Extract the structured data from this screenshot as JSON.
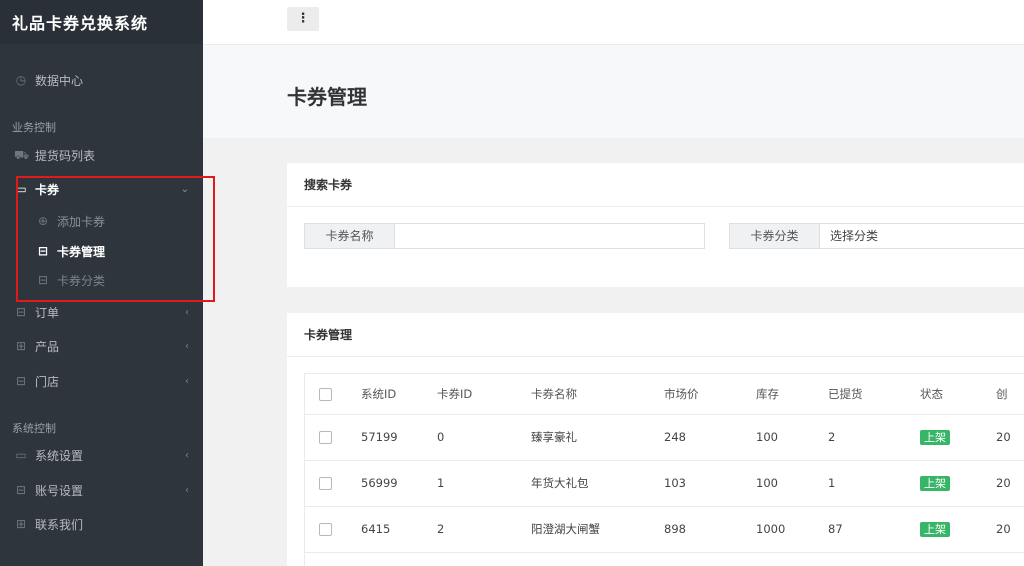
{
  "app": {
    "title": "礼品卡券兑换系统"
  },
  "sidebar": {
    "dashboard": "数据中心",
    "section_business": "业务控制",
    "pickup_list": "提货码列表",
    "coupon": "卡券",
    "coupon_add": "添加卡券",
    "coupon_manage": "卡券管理",
    "coupon_category": "卡券分类",
    "orders": "订单",
    "products": "产品",
    "stores": "门店",
    "section_system": "系统控制",
    "system_settings": "系统设置",
    "account_settings": "账号设置",
    "contact": "联系我们"
  },
  "topbar": {
    "menu_icon": "⋮"
  },
  "page": {
    "title": "卡券管理"
  },
  "search": {
    "header": "搜索卡券",
    "name_label": "卡券名称",
    "name_value": "",
    "category_label": "卡券分类",
    "category_value": "选择分类"
  },
  "table": {
    "header": "卡券管理",
    "columns": [
      "系统ID",
      "卡券ID",
      "卡券名称",
      "市场价",
      "库存",
      "已提货",
      "状态",
      "创"
    ],
    "rows": [
      {
        "sys_id": "57199",
        "card_id": "0",
        "name": "臻享豪礼",
        "price": "248",
        "stock": "100",
        "picked": "2",
        "status": "上架",
        "created": "20"
      },
      {
        "sys_id": "56999",
        "card_id": "1",
        "name": "年货大礼包",
        "price": "103",
        "stock": "100",
        "picked": "1",
        "status": "上架",
        "created": "20"
      },
      {
        "sys_id": "6415",
        "card_id": "2",
        "name": "阳澄湖大闸蟹",
        "price": "898",
        "stock": "1000",
        "picked": "87",
        "status": "上架",
        "created": "20"
      }
    ]
  },
  "colors": {
    "sidebar_bg": "#2f353d",
    "status_green": "#36b666",
    "highlight_red": "#e0191b"
  }
}
